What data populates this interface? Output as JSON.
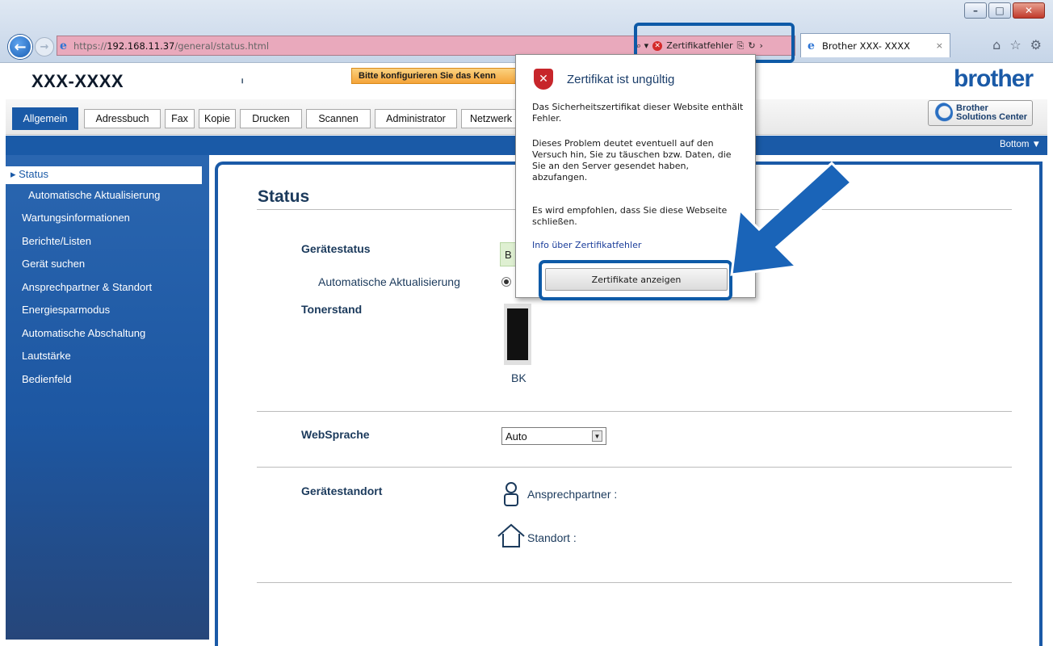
{
  "browser": {
    "address_prefix": "https://",
    "address_host": "192.168.11.37",
    "address_path": "/general/status.html",
    "cert_error_label": "Zertifikatfehler",
    "tab_title": "Brother XXX- XXXX",
    "minimize": "–",
    "maximize": "□",
    "close": "✕",
    "back": "←",
    "forward": "→",
    "tab_close": "×"
  },
  "header": {
    "model": "XXX-XXXX",
    "mark": "ₗ",
    "config_warning": "Bitte konfigurieren Sie das Kenn",
    "brand": "brother",
    "solutions_center": [
      "Brother",
      "Solutions Center"
    ]
  },
  "tabs": [
    "Allgemein",
    "Adressbuch",
    "Fax",
    "Kopie",
    "Drucken",
    "Scannen",
    "Administrator",
    "Netzwerk"
  ],
  "bottom_link": "Bottom ▼",
  "sidebar": {
    "items": [
      "▸ Status",
      "Automatische Aktualisierung",
      "Wartungsinformationen",
      "Berichte/Listen",
      "Gerät suchen",
      "Ansprechpartner & Standort",
      "Energiesparmodus",
      "Automatische Abschaltung",
      "Lautstärke",
      "Bedienfeld"
    ]
  },
  "main": {
    "title": "Status",
    "device_status_label": "Gerätestatus",
    "device_status_value": "B",
    "auto_update_label": "Automatische Aktualisierung",
    "toner_label": "Tonerstand",
    "toner_name": "BK",
    "toner_level": 1.0,
    "websprache_label": "WebSprache",
    "websprache_value": "Auto",
    "location_label": "Gerätestandort",
    "contact_label": "Ansprechpartner :",
    "location_value_label": "Standort :"
  },
  "popup": {
    "title": "Zertifikat ist ungültig",
    "p1": "Das Sicherheitszertifikat dieser Website enthält Fehler.",
    "p2": "Dieses Problem deutet eventuell auf den Versuch hin, Sie zu täuschen bzw. Daten, die Sie an den Server gesendet haben, abzufangen.",
    "p3": "Es wird empfohlen, dass Sie diese Webseite schließen.",
    "link": "Info über Zertifikatfehler",
    "button": "Zertifikate anzeigen"
  },
  "colors": {
    "accent_blue": "#1a5aa7",
    "highlight": "#0e5aa7",
    "address_error": "#e9a9bc"
  }
}
